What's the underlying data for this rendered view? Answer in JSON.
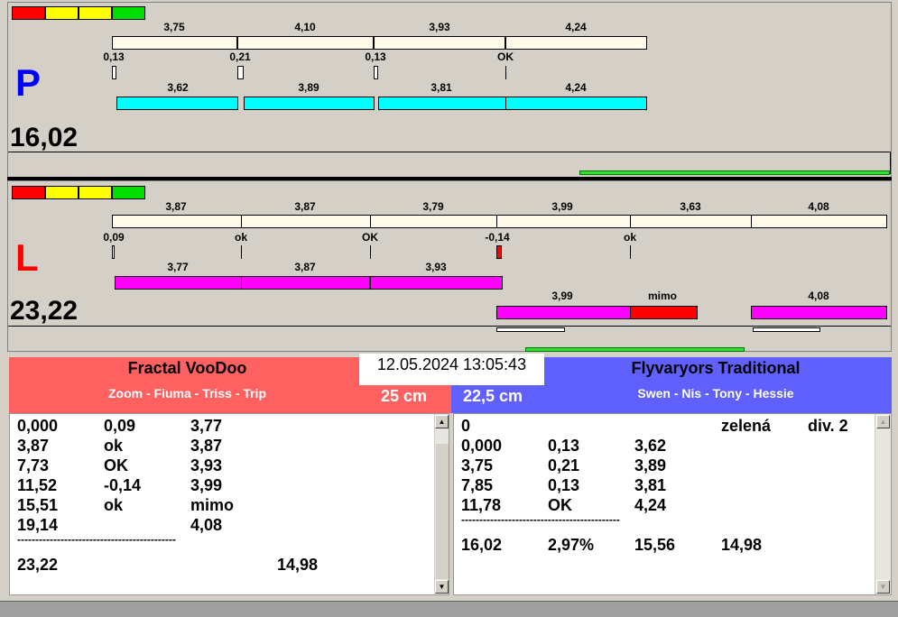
{
  "colors": {
    "cream": "#fffbe8",
    "cyan": "#00ffff",
    "magenta": "#ff00ff",
    "red": "#ff0000",
    "green": "#33dd33",
    "left_header": "#ff6060",
    "right_header": "#6060ff"
  },
  "top": {
    "letter": "P",
    "total": "16,02",
    "segments": [
      "3,75",
      "4,10",
      "3,93",
      "4,24"
    ],
    "marks": [
      "0,13",
      "0,21",
      "0,13",
      "OK"
    ],
    "cyan": [
      "3,62",
      "3,89",
      "3,81",
      "4,24"
    ]
  },
  "bottom": {
    "letter": "L",
    "total": "23,22",
    "segments": [
      "3,87",
      "3,87",
      "3,79",
      "3,99",
      "3,63",
      "4,08"
    ],
    "marks": [
      "0,09",
      "ok",
      "OK",
      "-0,14",
      "ok"
    ],
    "magenta": [
      "3,77",
      "3,87",
      "3,93"
    ],
    "magenta2": [
      "3,99",
      "mimo",
      "4,08"
    ]
  },
  "timestamp": "12.05.2024 13:05:43",
  "left_team": {
    "name": "Fractal VooDoo",
    "members": "Zoom - Fiuma - Triss - Trip",
    "size": "25 cm",
    "rows": [
      [
        "0,000",
        "0,09",
        "3,77"
      ],
      [
        "3,87",
        "ok",
        "3,87"
      ],
      [
        "7,73",
        "OK",
        "3,93"
      ],
      [
        "11,52",
        "-0,14",
        "3,99"
      ],
      [
        "15,51",
        "ok",
        "mimo"
      ],
      [
        "19,14",
        "",
        "4,08"
      ]
    ],
    "separator": "--------------------------------------------",
    "total": [
      "23,22",
      "14,98"
    ]
  },
  "right_team": {
    "name": "Flyvaryors Traditional",
    "members": "Swen - Nis - Tony - Hessie",
    "size": "22,5 cm",
    "first": [
      "0",
      "zelená",
      "div. 2"
    ],
    "rows": [
      [
        "0,000",
        "0,13",
        "3,62"
      ],
      [
        "3,75",
        "0,21",
        "3,89"
      ],
      [
        "7,85",
        "0,13",
        "3,81"
      ],
      [
        "11,78",
        "OK",
        "4,24"
      ]
    ],
    "separator": "--------------------------------------------",
    "total": [
      "16,02",
      "2,97%",
      "15,56",
      "14,98"
    ]
  }
}
